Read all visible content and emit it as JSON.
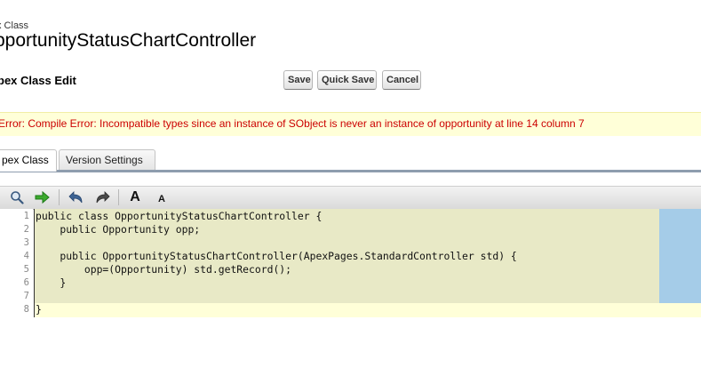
{
  "header": {
    "breadcrumb": "x Class",
    "title": "pportunityStatusChartController",
    "section_title": "pex Class Edit"
  },
  "buttons": {
    "save": "Save",
    "quick_save": "Quick Save",
    "cancel": "Cancel"
  },
  "error": {
    "message": "Error: Compile Error: Incompatible types since an instance of SObject is never an instance of opportunity at line 14 column 7",
    "color": "#cc0000",
    "background": "#ffffd8"
  },
  "tabs": [
    {
      "label": "pex Class",
      "active": true
    },
    {
      "label": "Version Settings",
      "active": false
    }
  ],
  "toolbar": {
    "icons": [
      "search-icon",
      "go-to-line-arrow-icon",
      "undo-icon",
      "redo-icon",
      "increase-font-icon",
      "decrease-font-icon"
    ],
    "increase_font_label": "A",
    "decrease_font_label": "A"
  },
  "editor": {
    "line_numbers": [
      "1",
      "2",
      "3",
      "4",
      "5",
      "6",
      "7",
      "8"
    ],
    "lines": [
      "public class OpportunityStatusChartController {",
      "    public Opportunity opp;",
      "",
      "    public OpportunityStatusChartController(ApexPages.StandardController std) {",
      "        opp=(Opportunity) std.getRecord();",
      "    }",
      "",
      "}"
    ],
    "colors": {
      "code_background": "#e8e9c6",
      "current_line_background": "#ffffd8",
      "side_panel": "#a5cce8"
    }
  }
}
